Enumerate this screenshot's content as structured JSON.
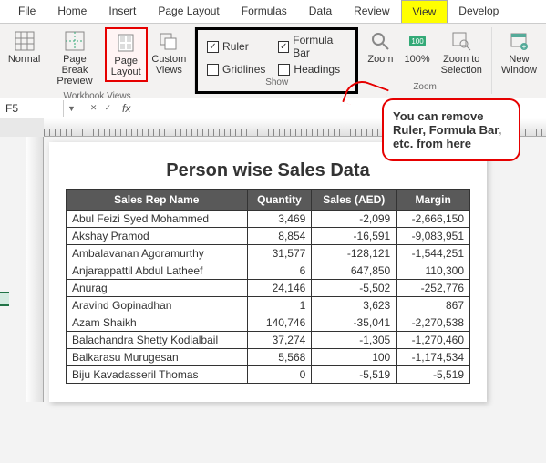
{
  "tabs": [
    "File",
    "Home",
    "Insert",
    "Page Layout",
    "Formulas",
    "Data",
    "Review",
    "View",
    "Develop"
  ],
  "workbook_views": {
    "normal": "Normal",
    "page_break": "Page Break\nPreview",
    "page_layout": "Page\nLayout",
    "custom": "Custom\nViews",
    "label": "Workbook Views"
  },
  "show": {
    "ruler": "Ruler",
    "formula_bar": "Formula Bar",
    "gridlines": "Gridlines",
    "headings": "Headings",
    "label": "Show"
  },
  "zoom": {
    "zoom": "Zoom",
    "hundred": "100%",
    "selection": "Zoom to\nSelection",
    "label": "Zoom"
  },
  "window": {
    "new": "New\nWindow"
  },
  "name_box": "F5",
  "callout": "You can remove Ruler, Formula Bar, etc. from here",
  "title": "Person wise Sales Data",
  "headers": [
    "Sales Rep Name",
    "Quantity",
    "Sales (AED)",
    "Margin"
  ],
  "rows": [
    [
      "Abul Feizi Syed Mohammed",
      "3,469",
      "-2,099",
      "-2,666,150"
    ],
    [
      "Akshay Pramod",
      "8,854",
      "-16,591",
      "-9,083,951"
    ],
    [
      "Ambalavanan Agoramurthy",
      "31,577",
      "-128,121",
      "-1,544,251"
    ],
    [
      "Anjarappattil Abdul Latheef",
      "6",
      "647,850",
      "110,300"
    ],
    [
      "Anurag",
      "24,146",
      "-5,502",
      "-252,776"
    ],
    [
      "Aravind Gopinadhan",
      "1",
      "3,623",
      "867"
    ],
    [
      "Azam Shaikh",
      "140,746",
      "-35,041",
      "-2,270,538"
    ],
    [
      "Balachandra Shetty Kodialbail",
      "37,274",
      "-1,305",
      "-1,270,460"
    ],
    [
      "Balkarasu Murugesan",
      "5,568",
      "100",
      "-1,174,534"
    ],
    [
      "Biju Kavadasseril Thomas",
      "0",
      "-5,519",
      "-5,519"
    ]
  ],
  "chart_data": {
    "type": "table",
    "title": "Person wise Sales Data",
    "columns": [
      "Sales Rep Name",
      "Quantity",
      "Sales (AED)",
      "Margin"
    ],
    "data": [
      {
        "name": "Abul Feizi Syed Mohammed",
        "quantity": 3469,
        "sales": -2099,
        "margin": -2666150
      },
      {
        "name": "Akshay Pramod",
        "quantity": 8854,
        "sales": -16591,
        "margin": -9083951
      },
      {
        "name": "Ambalavanan Agoramurthy",
        "quantity": 31577,
        "sales": -128121,
        "margin": -1544251
      },
      {
        "name": "Anjarappattil Abdul Latheef",
        "quantity": 6,
        "sales": 647850,
        "margin": 110300
      },
      {
        "name": "Anurag",
        "quantity": 24146,
        "sales": -5502,
        "margin": -252776
      },
      {
        "name": "Aravind Gopinadhan",
        "quantity": 1,
        "sales": 3623,
        "margin": 867
      },
      {
        "name": "Azam Shaikh",
        "quantity": 140746,
        "sales": -35041,
        "margin": -2270538
      },
      {
        "name": "Balachandra Shetty Kodialbail",
        "quantity": 37274,
        "sales": -1305,
        "margin": -1270460
      },
      {
        "name": "Balkarasu Murugesan",
        "quantity": 5568,
        "sales": 100,
        "margin": -1174534
      },
      {
        "name": "Biju Kavadasseril Thomas",
        "quantity": 0,
        "sales": -5519,
        "margin": -5519
      }
    ]
  }
}
